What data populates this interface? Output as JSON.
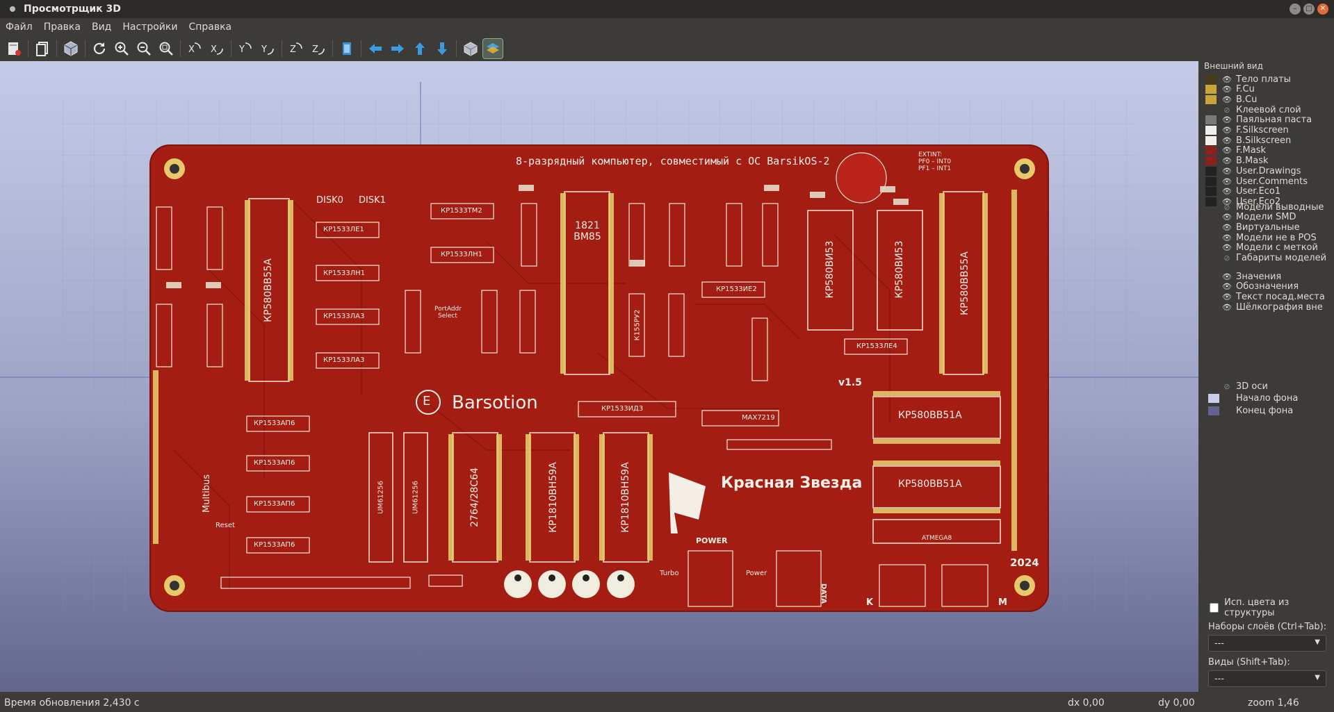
{
  "window": {
    "title": "Просмотрщик 3D"
  },
  "menu": [
    "Файл",
    "Правка",
    "Вид",
    "Настройки",
    "Справка"
  ],
  "toolbar": {
    "buttons": [
      "export-icon",
      "copy-icon",
      "box-icon",
      "reload-icon",
      "zoom-in-icon",
      "zoom-out-icon",
      "zoom-fit-icon",
      "rotate-x-cw-icon",
      "rotate-x-ccw-icon",
      "rotate-y-cw-icon",
      "rotate-y-ccw-icon",
      "rotate-z-cw-icon",
      "rotate-z-ccw-icon",
      "flip-icon",
      "arrow-left-icon",
      "arrow-right-icon",
      "arrow-up-icon",
      "arrow-down-icon",
      "perspective-icon",
      "layers-icon"
    ]
  },
  "board": {
    "title": "8-разрядный компьютер, совместимый с ОС BarsikOS-2",
    "brand": "Barsotion",
    "logo_letter": "E",
    "star_text": "Красная Звезда",
    "version": "v1.5",
    "year": "2024",
    "extint": [
      "EXTINT:",
      "PF0 – INT0",
      "PF1 – INT1"
    ],
    "bus": "Multibus",
    "reset": "Reset",
    "power": "POWER",
    "turbo": "Turbo",
    "power2": "Power",
    "data": "DATA",
    "k": "K",
    "m": "M",
    "disk0": "DISK0",
    "disk1": "DISK1",
    "port_addr": [
      "PortAddr",
      "Select"
    ],
    "chips": [
      {
        "id": "c1",
        "label": "КР580ВВ55А"
      },
      {
        "id": "c2",
        "label": "КР580ВВ55А"
      },
      {
        "id": "c3",
        "label": "КР580ВИ53"
      },
      {
        "id": "c4",
        "label": "КР580ВИ53"
      },
      {
        "id": "c5",
        "label": "1821 ВМ85"
      },
      {
        "id": "c6",
        "label": "КР580ВВ51А"
      },
      {
        "id": "c7",
        "label": "КР580ВВ51А"
      },
      {
        "id": "c8",
        "label": "2764/28С64"
      },
      {
        "id": "c9",
        "label": "КР1810ВН59А"
      },
      {
        "id": "c10",
        "label": "КР1810ВН59А"
      },
      {
        "id": "c11",
        "label": "UM61256"
      },
      {
        "id": "c12",
        "label": "UM61256"
      },
      {
        "id": "c13",
        "label": "КР1533ЛЕ1"
      },
      {
        "id": "c14",
        "label": "КР1533ЛН1"
      },
      {
        "id": "c15",
        "label": "КР1533ЛА3"
      },
      {
        "id": "c16",
        "label": "КР1533ЛА3"
      },
      {
        "id": "c17",
        "label": "КР1533ТМ2"
      },
      {
        "id": "c18",
        "label": "КР1533ЛН1"
      },
      {
        "id": "c19",
        "label": "КР1533АП6"
      },
      {
        "id": "c20",
        "label": "КР1533АП6"
      },
      {
        "id": "c21",
        "label": "КР1533АП6"
      },
      {
        "id": "c22",
        "label": "КР1533АП6"
      },
      {
        "id": "c23",
        "label": "КР1533ИД3"
      },
      {
        "id": "c24",
        "label": "MAX7219"
      },
      {
        "id": "c25",
        "label": "ATMEGA8"
      },
      {
        "id": "c26",
        "label": "КР1533ИЕ2"
      },
      {
        "id": "c27",
        "label": "КР1533ЛЕ4"
      },
      {
        "id": "c28",
        "label": "К155РУ2"
      }
    ]
  },
  "panel": {
    "title": "Внешний вид",
    "layers": [
      {
        "label": "Тело платы",
        "color": "#4a3a1c",
        "eye": true
      },
      {
        "label": "F.Cu",
        "color": "#c8a43a",
        "eye": true
      },
      {
        "label": "B.Cu",
        "color": "#c8a43a",
        "eye": true
      },
      {
        "label": "Клеевой слой",
        "color": "",
        "eye": false
      },
      {
        "label": "Паяльная паста",
        "color": "#7a7a7a",
        "eye": true
      },
      {
        "label": "F.Silkscreen",
        "color": "#f0f0e8",
        "eye": true
      },
      {
        "label": "B.Silkscreen",
        "color": "#f0f0e8",
        "eye": true
      },
      {
        "label": "F.Mask",
        "color": "#8a2020",
        "eye": true
      },
      {
        "label": "B.Mask",
        "color": "#8a2020",
        "eye": true
      },
      {
        "label": "User.Drawings",
        "color": "#222222",
        "eye": true
      },
      {
        "label": "User.Comments",
        "color": "#222222",
        "eye": true
      },
      {
        "label": "User.Eco1",
        "color": "#222222",
        "eye": true
      },
      {
        "label": "User.Eco2",
        "color": "#222222",
        "eye": true
      }
    ],
    "models": [
      {
        "label": "Модели выводные",
        "eye": false
      },
      {
        "label": "Модели SMD",
        "eye": true
      },
      {
        "label": "Виртуальные",
        "eye": true
      },
      {
        "label": "Модели не в POS",
        "eye": true
      },
      {
        "label": "Модели с меткой",
        "eye": true
      },
      {
        "label": "Габариты моделей",
        "eye": false
      }
    ],
    "texts": [
      {
        "label": "Значения",
        "eye": true
      },
      {
        "label": "Обозначения",
        "eye": true
      },
      {
        "label": "Текст посад.места",
        "eye": true
      },
      {
        "label": "Шёлкография вне",
        "eye": true
      }
    ],
    "axes": {
      "label": "3D оси",
      "eye": false
    },
    "bg_start": {
      "label": "Начало фона",
      "color": "#c9cde8"
    },
    "bg_end": {
      "label": "Конец фона",
      "color": "#62658b"
    },
    "use_struct_colors": "Исп. цвета из структуры",
    "layer_sets_label": "Наборы слоёв (Ctrl+Tab):",
    "layer_sets_value": "---",
    "views_label": "Виды (Shift+Tab):",
    "views_value": "---"
  },
  "status": {
    "update_time": "Время обновления 2,430 с",
    "dx": "dx 0,00",
    "dy": "dy 0,00",
    "zoom": "zoom 1,46"
  }
}
